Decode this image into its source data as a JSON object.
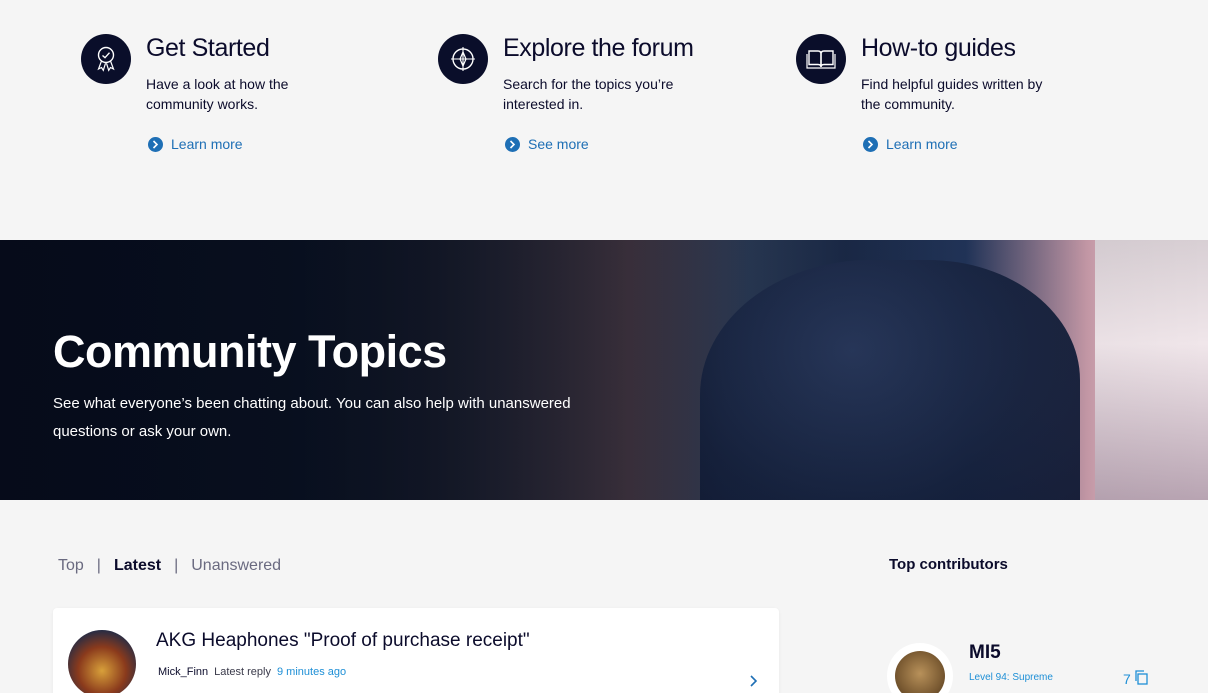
{
  "features": [
    {
      "icon": "award-ribbon-icon",
      "title": "Get Started",
      "desc": "Have a look at how the community works.",
      "link": "Learn more"
    },
    {
      "icon": "compass-icon",
      "title": "Explore the forum",
      "desc": "Search for the topics you’re interested in.",
      "link": "See more"
    },
    {
      "icon": "open-book-icon",
      "title": "How-to guides",
      "desc": "Find helpful guides written by the community.",
      "link": "Learn more"
    }
  ],
  "hero": {
    "title": "Community Topics",
    "subtitle": "See what everyone’s been chatting about. You can also help with unanswered questions or ask your own."
  },
  "tabs": [
    {
      "label": "Top",
      "active": false
    },
    {
      "label": "Latest",
      "active": true
    },
    {
      "label": "Unanswered",
      "active": false
    }
  ],
  "topics": [
    {
      "title": "AKG Heaphones \"Proof of purchase receipt\"",
      "author": "Mick_Finn",
      "reply_label": "Latest reply",
      "when": "9 minutes ago"
    }
  ],
  "contributors": {
    "heading": "Top contributors",
    "items": [
      {
        "name": "MI5",
        "level": "Level 94: Supreme",
        "count": "7"
      }
    ]
  },
  "colors": {
    "navy": "#0a0e2a",
    "link_blue": "#1e6fb5",
    "meta_blue": "#1e8fd6"
  }
}
